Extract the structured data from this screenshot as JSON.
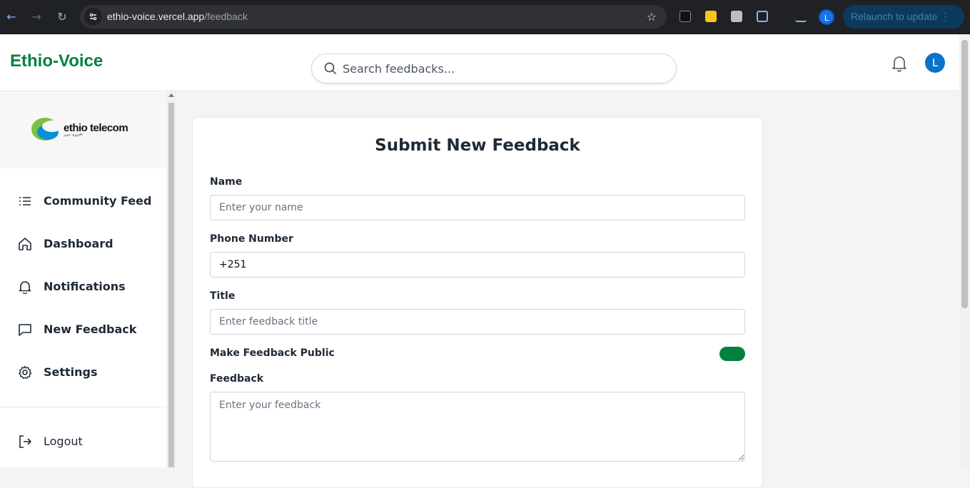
{
  "browser": {
    "url_host": "ethio-voice.vercel.app",
    "url_path": "/feedback",
    "profile_initial": "L",
    "relaunch_label": "Relaunch to update"
  },
  "header": {
    "brand": "Ethio-Voice",
    "search_placeholder": "Search feedbacks...",
    "user_initial": "L"
  },
  "sidebar": {
    "logo_text": "ethio telecom",
    "logo_sub": "ኢትዮ ቴሌኮም",
    "items": [
      {
        "label": "Community Feed",
        "icon": "list-icon"
      },
      {
        "label": "Dashboard",
        "icon": "home-icon"
      },
      {
        "label": "Notifications",
        "icon": "bell-icon"
      },
      {
        "label": "New Feedback",
        "icon": "message-icon"
      },
      {
        "label": "Settings",
        "icon": "gear-icon"
      }
    ],
    "logout": "Logout"
  },
  "form": {
    "title": "Submit New Feedback",
    "name_label": "Name",
    "name_placeholder": "Enter your name",
    "phone_label": "Phone Number",
    "phone_value": "+251",
    "title_label": "Title",
    "title_placeholder": "Enter feedback title",
    "public_label": "Make Feedback Public",
    "public_enabled": true,
    "feedback_label": "Feedback",
    "feedback_placeholder": "Enter your feedback"
  },
  "colors": {
    "brand_green": "#03803d",
    "avatar_blue": "#0a73c9"
  }
}
